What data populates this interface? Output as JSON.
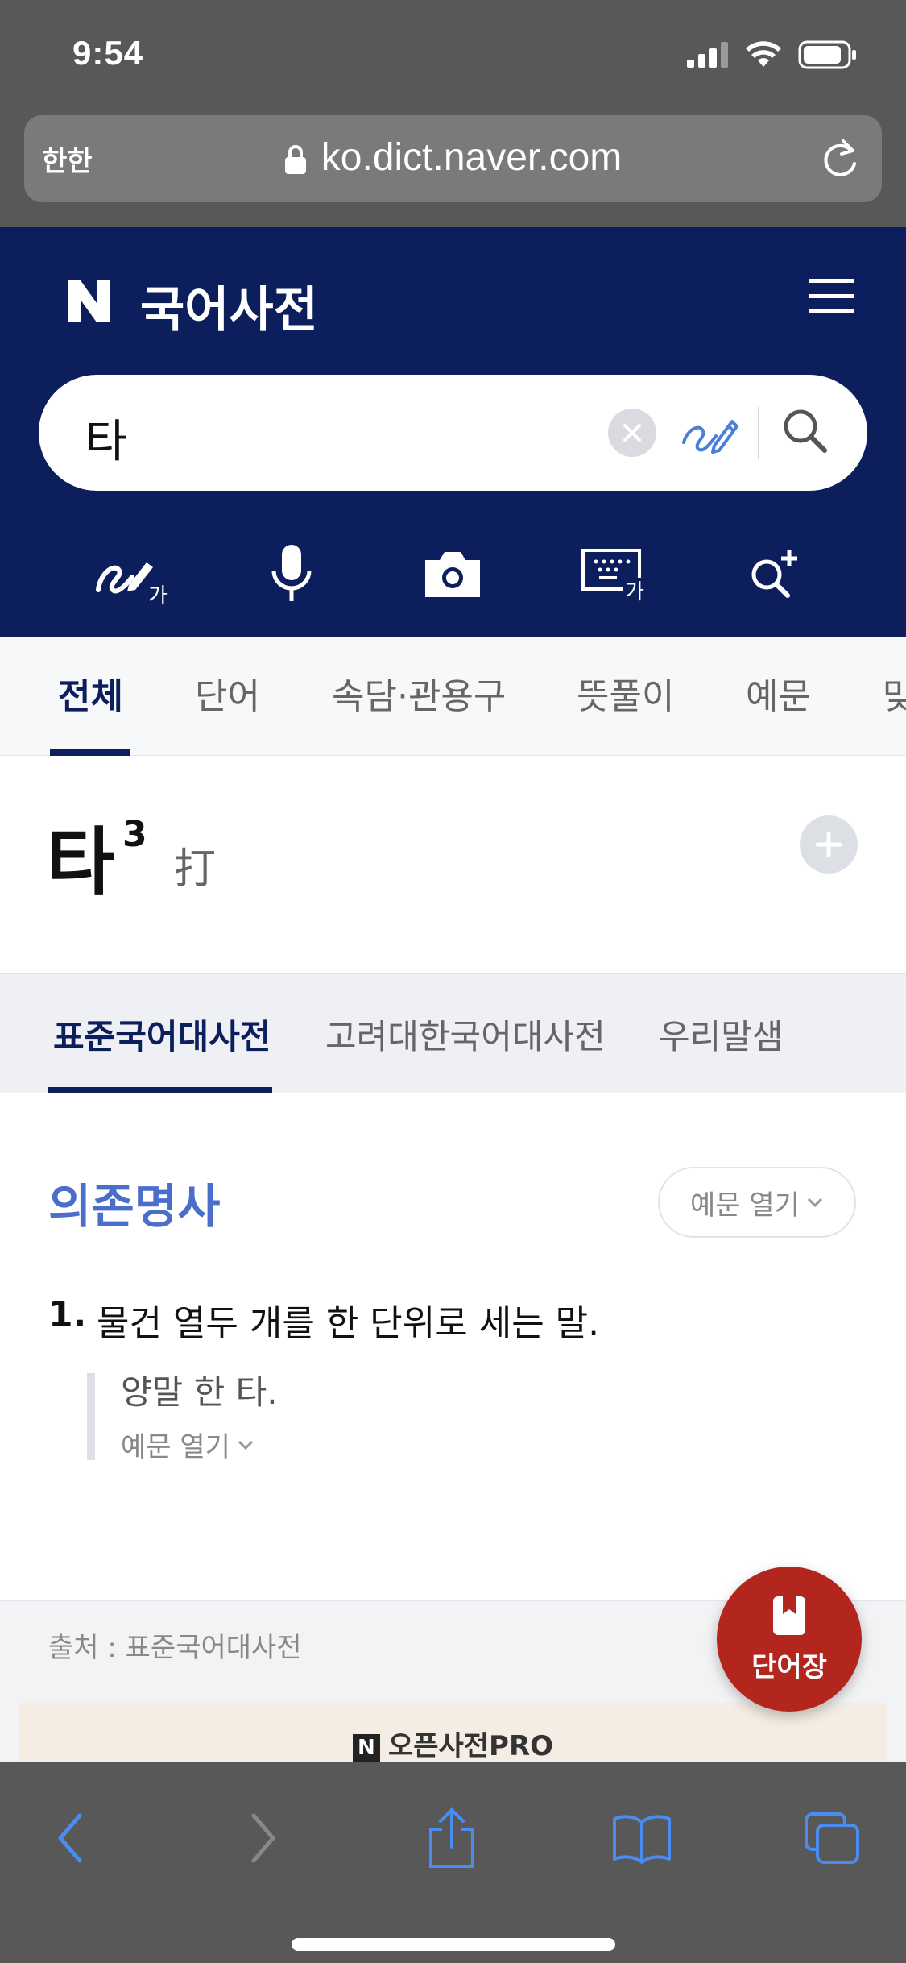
{
  "status_bar": {
    "time": "9:54"
  },
  "browser": {
    "text_size_button": "한한",
    "url": "ko.dict.naver.com"
  },
  "header": {
    "logo_letter": "N",
    "title": "국어사전"
  },
  "search": {
    "value": "타"
  },
  "tools": {
    "handwrite_badge": "가",
    "keyboard_badge": "가"
  },
  "tabs": [
    "전체",
    "단어",
    "속담·관용구",
    "뜻풀이",
    "예문",
    "맞"
  ],
  "entry": {
    "headword": "타",
    "superscript": "3",
    "hanja": "打"
  },
  "source_tabs": [
    "표준국어대사전",
    "고려대한국어대사전",
    "우리말샘"
  ],
  "definition": {
    "part_of_speech": "의존명사",
    "example_toggle": "예문 열기",
    "number": "1.",
    "text": "물건 열두 개를 한 단위로 세는 말.",
    "example": "양말 한 타.",
    "example_more": "예문 열기"
  },
  "footer": {
    "source": "출처 : 표준국어대사전",
    "promo_logo": "N",
    "promo_text": "오픈사전PRO"
  },
  "fab": {
    "label": "단어장"
  },
  "colors": {
    "naver_navy": "#0c1f5c",
    "pos_blue": "#4a6fc8",
    "fab_red": "#b3261e",
    "safari_chrome": "#585858"
  }
}
